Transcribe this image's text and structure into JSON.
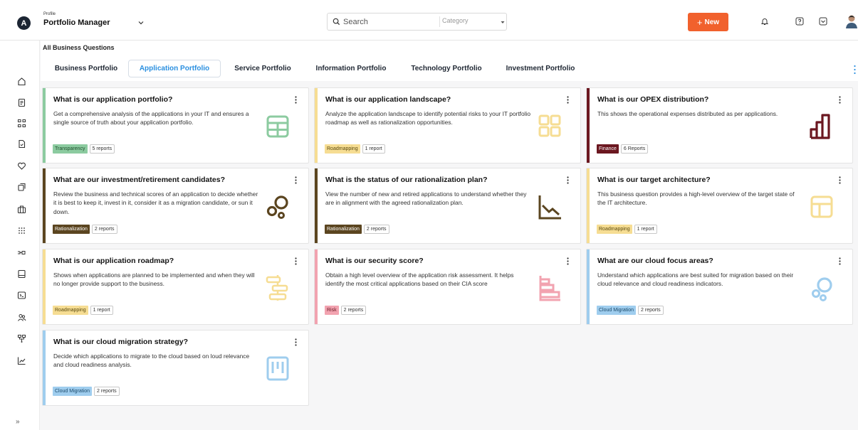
{
  "topbar": {
    "logo_letter": "A",
    "profile_caption": "Profile",
    "profile_name": "Portfolio Manager",
    "search_placeholder": "Search",
    "category_placeholder": "Category",
    "new_label": "New",
    "new_plus": "+",
    "accent_color": "#f1612d"
  },
  "sidebar": {
    "icons": [
      "home-icon",
      "document-icon",
      "org-chart-icon",
      "file-icon",
      "heart-icon",
      "layers-icon",
      "briefcase-icon",
      "grid-icon",
      "cable-icon",
      "server-icon",
      "terminal-icon",
      "users-icon",
      "network-icon",
      "analytics-icon"
    ],
    "expand_label": "»"
  },
  "page": {
    "section_title": "All Business Questions",
    "tabs": [
      {
        "label": "Business Portfolio"
      },
      {
        "label": "Application Portfolio"
      },
      {
        "label": "Service Portfolio"
      },
      {
        "label": "Information Portfolio"
      },
      {
        "label": "Technology Portfolio"
      },
      {
        "label": "Investment Portfolio"
      }
    ],
    "active_tab": "Application Portfolio"
  },
  "cards": [
    {
      "title": "What is our application portfolio?",
      "description": "Get a comprehensive analysis of the applications in your IT and ensures a single source of truth about your application portfolio.",
      "tag": "Transparency",
      "count": "5 reports",
      "color": "#8ccba0",
      "tag_text": "#1d4d2b",
      "icon": "table-icon"
    },
    {
      "title": "What is our application landscape?",
      "description": "Analyze the application landscape to identify potential risks to your IT portfolio roadmap as well as rationalization opportunities.",
      "tag": "Roadmapping",
      "count": "1 report",
      "color": "#f6dd93",
      "tag_text": "#5a4a10",
      "icon": "apps-grid-icon"
    },
    {
      "title": "What is our OPEX distribution?",
      "description": "This shows the operational expenses distributed as per applications.",
      "tag": "Finance",
      "count": "6 Reports",
      "color": "#6b1720",
      "tag_text": "#ffffff",
      "icon": "bar-chart-icon"
    },
    {
      "title": "What are our investment/retirement candidates?",
      "description": "Review the business and technical scores of an application to decide whether it is best to keep it, invest in it, consider it as a migration candidate, or sun it down.",
      "tag": "Rationalization",
      "count": "2 reports",
      "color": "#5b4520",
      "tag_text": "#ffffff",
      "icon": "bubbles-icon"
    },
    {
      "title": "What is the status of our rationalization plan?",
      "description": "View the number of new and retired applications to understand whether they are in alignment with the agreed rationalization plan.",
      "tag": "Rationalization",
      "count": "2 reports",
      "color": "#5b4520",
      "tag_text": "#ffffff",
      "icon": "trend-down-icon"
    },
    {
      "title": "What is our target architecture?",
      "description": "This business question provides a high-level overview of the target state of the IT architecture.",
      "tag": "Roadmapping",
      "count": "1 report",
      "color": "#f6dd93",
      "tag_text": "#5a4a10",
      "icon": "layout-icon"
    },
    {
      "title": "What is our application roadmap?",
      "description": "Shows when applications are planned to be implemented and when they will no longer provide support to the business.",
      "tag": "Roadmapping",
      "count": "1 report",
      "color": "#f6dd93",
      "tag_text": "#5a4a10",
      "icon": "roadmap-icon"
    },
    {
      "title": "What is our security score?",
      "description": "Obtain a high level overview of the application risk assessment. It helps identify the most critical applications based on their CIA score",
      "tag": "Risk",
      "count": "2 reports",
      "color": "#f2a3b0",
      "tag_text": "#6a1a26",
      "icon": "stacked-bars-icon"
    },
    {
      "title": "What are our cloud focus areas?",
      "description": "Understand which applications are best suited for migration based on their cloud relevance and cloud readiness indicators.",
      "tag": "Cloud Migration",
      "count": "2 reports",
      "color": "#9fcdee",
      "tag_text": "#1b4a6b",
      "icon": "cloud-bubbles-icon"
    },
    {
      "title": "What is our cloud migration strategy?",
      "description": "Decide which applications to migrate to the cloud based on loud relevance and cloud readiness analysis.",
      "tag": "Cloud Migration",
      "count": "2 reports",
      "color": "#9fcdee",
      "tag_text": "#1b4a6b",
      "icon": "kanban-icon"
    }
  ]
}
